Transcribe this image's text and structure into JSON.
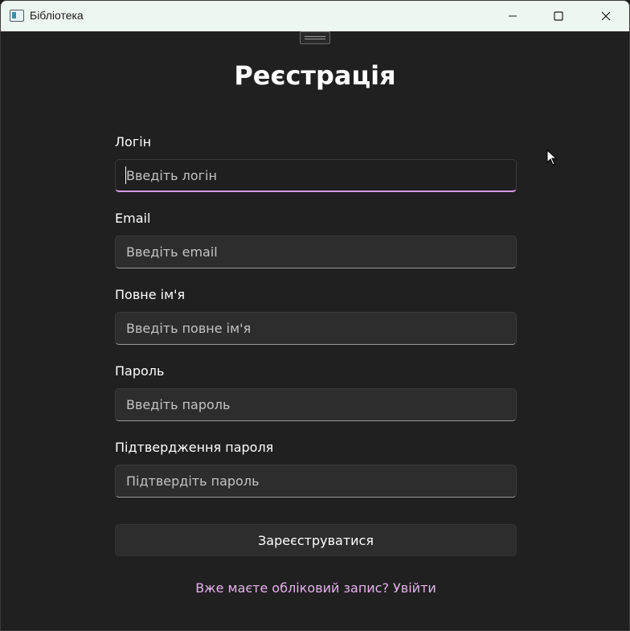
{
  "window": {
    "title": "Бібліотека",
    "controls": {
      "minimize": "minimize-icon",
      "maximize": "maximize-icon",
      "close": "close-icon"
    }
  },
  "form": {
    "title": "Реєстрація",
    "fields": [
      {
        "label": "Логін",
        "placeholder": "Введіть логін",
        "value": ""
      },
      {
        "label": "Email",
        "placeholder": "Введіть email",
        "value": ""
      },
      {
        "label": "Повне ім'я",
        "placeholder": "Введіть повне ім'я",
        "value": ""
      },
      {
        "label": "Пароль",
        "placeholder": "Введіть пароль",
        "value": ""
      },
      {
        "label": "Підтвердження пароля",
        "placeholder": "Підтвердіть пароль",
        "value": ""
      }
    ],
    "submit_label": "Зареєструватися",
    "login_link": "Вже маєте обліковий запис? Увійти"
  },
  "colors": {
    "background": "#202020",
    "input_background": "#2d2d2d",
    "focus_accent": "#d89be8",
    "link": "#e6b3ec",
    "titlebar": "#eef6f2"
  }
}
